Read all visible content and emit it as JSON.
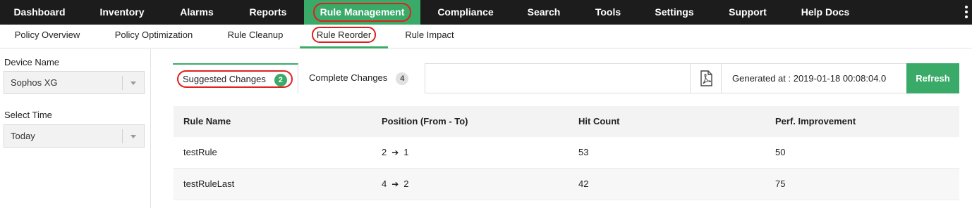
{
  "top_nav": [
    {
      "label": "Dashboard"
    },
    {
      "label": "Inventory"
    },
    {
      "label": "Alarms"
    },
    {
      "label": "Reports"
    },
    {
      "label": "Rule Management",
      "active": true
    },
    {
      "label": "Compliance"
    },
    {
      "label": "Search"
    },
    {
      "label": "Tools"
    },
    {
      "label": "Settings"
    },
    {
      "label": "Support"
    },
    {
      "label": "Help Docs"
    }
  ],
  "sub_nav": [
    {
      "label": "Policy Overview"
    },
    {
      "label": "Policy Optimization"
    },
    {
      "label": "Rule Cleanup"
    },
    {
      "label": "Rule Reorder",
      "active": true
    },
    {
      "label": "Rule Impact"
    }
  ],
  "sidebar": {
    "device_label": "Device Name",
    "device_value": "Sophos XG",
    "time_label": "Select Time",
    "time_value": "Today"
  },
  "tabs": [
    {
      "label": "Suggested Changes",
      "count": "2",
      "active": true
    },
    {
      "label": "Complete Changes",
      "count": "4",
      "active": false
    }
  ],
  "toolbar": {
    "pdf_icon": "pdf-icon",
    "generated_at": "Generated at : 2019-01-18 00:08:04.0",
    "refresh_label": "Refresh"
  },
  "table": {
    "columns": [
      "Rule Name",
      "Position (From - To)",
      "Hit Count",
      "Perf. Improvement"
    ],
    "rows": [
      {
        "rule_name": "testRule",
        "from": "2",
        "to": "1",
        "hit_count": "53",
        "perf": "50"
      },
      {
        "rule_name": "testRuleLast",
        "from": "4",
        "to": "2",
        "hit_count": "42",
        "perf": "75"
      }
    ]
  },
  "colors": {
    "accent": "#3aaa68",
    "nav_bg": "#1c1c1c",
    "highlight_ring": "#e0201e"
  }
}
